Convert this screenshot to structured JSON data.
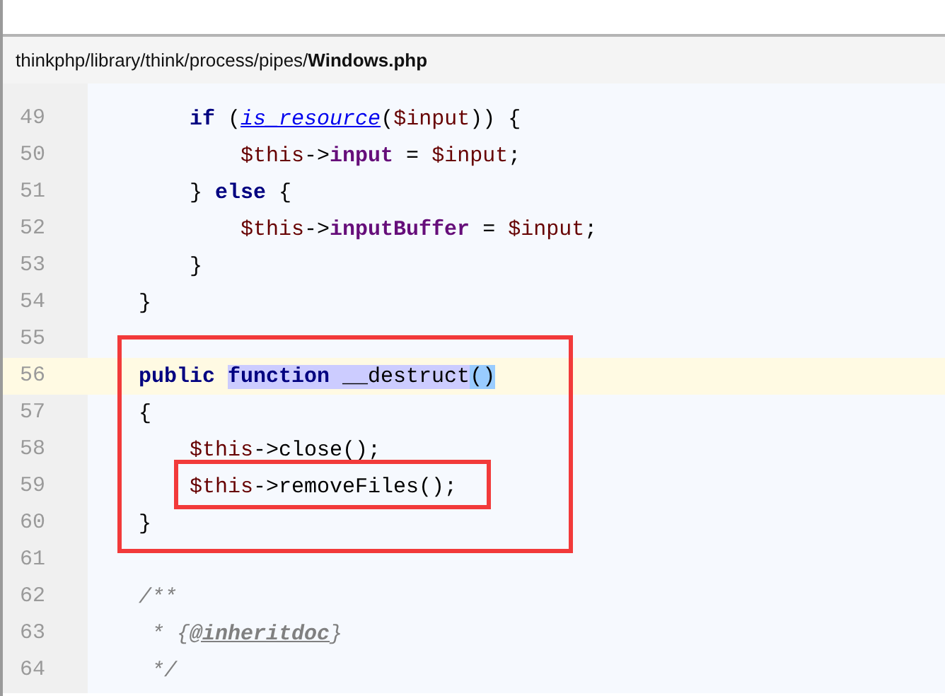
{
  "file_path": "thinkphp/library/think/process/pipes/**Windows.php**",
  "lines": [
    {
      "children": [
        {
          "number": "49",
          "current": false,
          "tokens": [
            {
              "kind": "keyword",
              "text": "if"
            },
            {
              "kind": "plain",
              "text": " ("
            },
            {
              "kind": "link",
              "text": "is_resource"
            },
            {
              "kind": "plain",
              "text": "("
            },
            {
              "kind": "variable",
              "text": "$input"
            },
            {
              "kind": "plain",
              "text": ")) {"
            }
          ],
          "children": [
            {
              "number": "50",
              "current": false,
              "tokens": [
                {
                  "kind": "variable",
                  "text": "$this"
                },
                {
                  "kind": "plain",
                  "text": "->"
                },
                {
                  "kind": "property",
                  "text": "input"
                },
                {
                  "kind": "plain",
                  "text": " = "
                },
                {
                  "kind": "variable",
                  "text": "$input"
                },
                {
                  "kind": "plain",
                  "text": ";"
                }
              ]
            }
          ]
        },
        {
          "number": "51",
          "current": false,
          "tokens": [
            {
              "kind": "plain",
              "text": "} "
            },
            {
              "kind": "keyword",
              "text": "else"
            },
            {
              "kind": "plain",
              "text": " {"
            }
          ],
          "children": [
            {
              "number": "52",
              "current": false,
              "tokens": [
                {
                  "kind": "variable",
                  "text": "$this"
                },
                {
                  "kind": "plain",
                  "text": "->"
                },
                {
                  "kind": "property",
                  "text": "inputBuffer"
                },
                {
                  "kind": "plain",
                  "text": " = "
                },
                {
                  "kind": "variable",
                  "text": "$input"
                },
                {
                  "kind": "plain",
                  "text": ";"
                }
              ]
            }
          ]
        },
        {
          "number": "53",
          "current": false,
          "tokens": [
            {
              "kind": "plain",
              "text": "}"
            }
          ]
        }
      ]
    },
    {
      "number": "54",
      "current": false,
      "tokens": [
        {
          "kind": "plain",
          "text": "}"
        }
      ]
    },
    {
      "number": "55",
      "current": false
    },
    {
      "number": "56",
      "current": true,
      "tokens": [
        {
          "kind": "keyword",
          "text": "public "
        },
        {
          "kind": "keyword-match",
          "text": "function"
        },
        {
          "kind": "match",
          "text": " __destruct"
        },
        {
          "kind": "brace-match",
          "text": "()"
        }
      ]
    },
    {
      "number": "57",
      "current": false,
      "tokens": [
        {
          "kind": "plain",
          "text": "{"
        }
      ],
      "children": [
        {
          "number": "58",
          "current": false,
          "tokens": [
            {
              "kind": "variable",
              "text": "$this"
            },
            {
              "kind": "plain",
              "text": "->close();"
            }
          ]
        },
        {
          "number": "59",
          "current": false,
          "tokens": [
            {
              "kind": "variable",
              "text": "$this"
            },
            {
              "kind": "plain",
              "text": "->removeFiles();"
            }
          ]
        }
      ]
    },
    {
      "number": "60",
      "current": false,
      "tokens": [
        {
          "kind": "plain",
          "text": "}"
        }
      ]
    },
    {
      "number": "61",
      "current": false
    },
    {
      "number": "62",
      "current": false,
      "tokens": [
        {
          "kind": "comment",
          "text": "/**"
        }
      ]
    },
    {
      "number": "63",
      "current": false,
      "tokens": [
        {
          "kind": "comment",
          "text": " * {"
        },
        {
          "kind": "doc-tag",
          "text": "@inheritdoc"
        },
        {
          "kind": "comment",
          "text": "}"
        }
      ]
    },
    {
      "number": "64",
      "current": false,
      "tokens": [
        {
          "kind": "comment",
          "text": " */"
        }
      ]
    }
  ]
}
